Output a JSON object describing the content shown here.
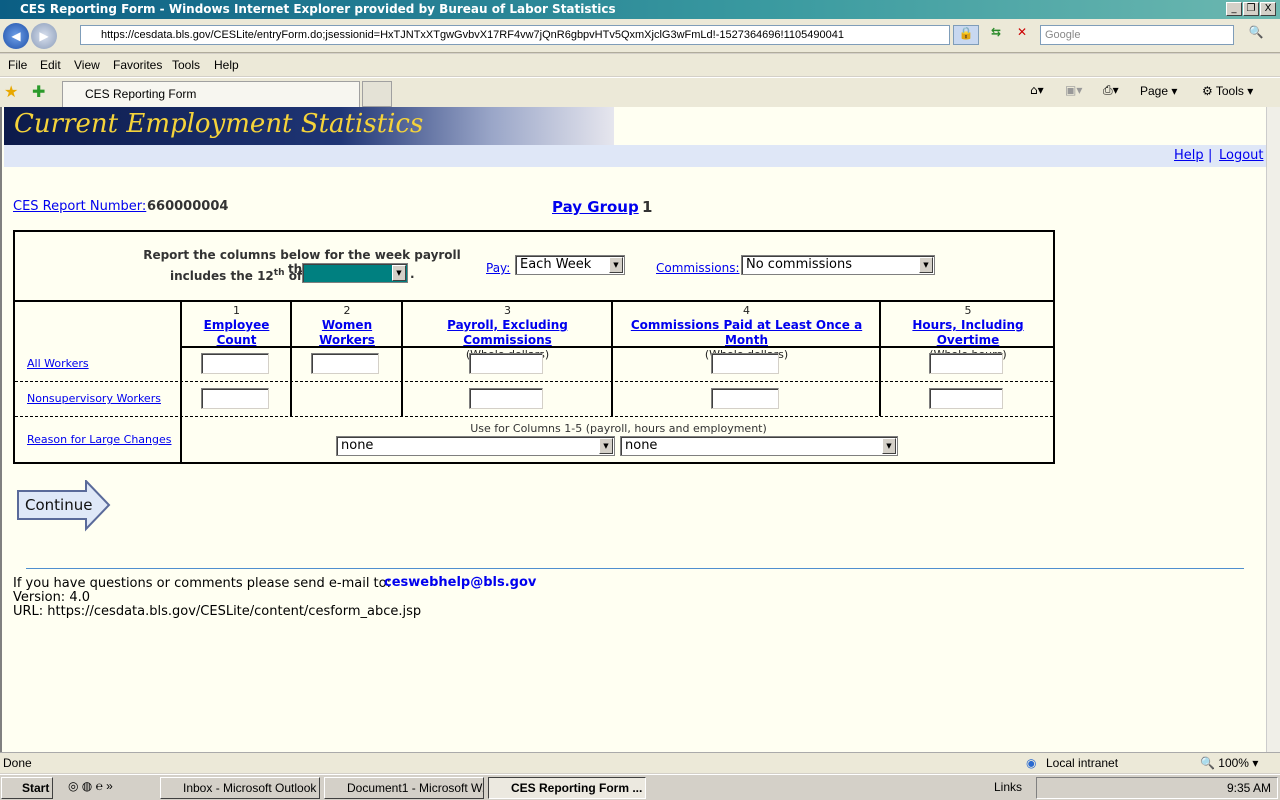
{
  "window": {
    "title": "CES Reporting Form - Windows Internet Explorer provided by Bureau of Labor Statistics",
    "address": "https://cesdata.bls.gov/CESLite/entryForm.do;jsessionid=HxTJNTxXTgwGvbvX17RF4vw7jQnR6gbpvHTv5QxmXjclG3wFmLd!-1527364696!1105490041",
    "search_placeholder": "Google",
    "tab": "CES Reporting Form",
    "menu": [
      "File",
      "Edit",
      "View",
      "Favorites",
      "Tools",
      "Help"
    ],
    "toolbar": {
      "page": "Page",
      "tools": "Tools"
    }
  },
  "banner": "Current Employment Statistics",
  "links": {
    "help": "Help",
    "sep": "|",
    "logout": "Logout"
  },
  "report": {
    "label": "CES Report Number:",
    "number": "660000004",
    "pay_group_label": "Pay Group",
    "pay_group": "1"
  },
  "form": {
    "intro1": "Report the columns below for the week payroll that",
    "intro2a": "includes the 12",
    "intro2sup": "th",
    "intro2b": "of",
    "period": ".",
    "pay_label": "Pay:",
    "pay_value": "Each Week",
    "commissions_label": "Commissions:",
    "commissions_value": "No commissions",
    "columns": [
      {
        "num": "1",
        "title": "Employee Count",
        "unit": ""
      },
      {
        "num": "2",
        "title": "Women Workers",
        "unit": ""
      },
      {
        "num": "3",
        "title": "Payroll, Excluding Commissions",
        "unit": "(Whole dollars)"
      },
      {
        "num": "4",
        "title": "Commissions Paid at Least Once a Month",
        "unit": "(Whole dollars)"
      },
      {
        "num": "5",
        "title": "Hours, Including Overtime",
        "unit": "(Whole hours)"
      }
    ],
    "rows": [
      "All Workers",
      "Nonsupervisory Workers",
      "Reason for Large Changes"
    ],
    "reason_note": "Use for Columns 1-5 (payroll, hours and employment)",
    "reason1": "none",
    "reason2": "none",
    "continue": "Continue"
  },
  "footer": {
    "contact": "If you have questions or comments please send e-mail to:",
    "email": "ceswebhelp@bls.gov",
    "version": "Version: 4.0",
    "url": "URL: https://cesdata.bls.gov/CESLite/content/cesform_abce.jsp"
  },
  "status": {
    "text": "Done",
    "zone": "Local intranet",
    "zoom": "100%"
  },
  "taskbar": {
    "start": "Start",
    "items": [
      "Inbox - Microsoft Outlook",
      "Document1 - Microsoft W...",
      "CES Reporting Form ..."
    ],
    "links": "Links",
    "time": "9:35 AM"
  },
  "colors": {
    "accent": "#0000ee",
    "period_select": "#008080",
    "page_bg": "#fffff2"
  }
}
